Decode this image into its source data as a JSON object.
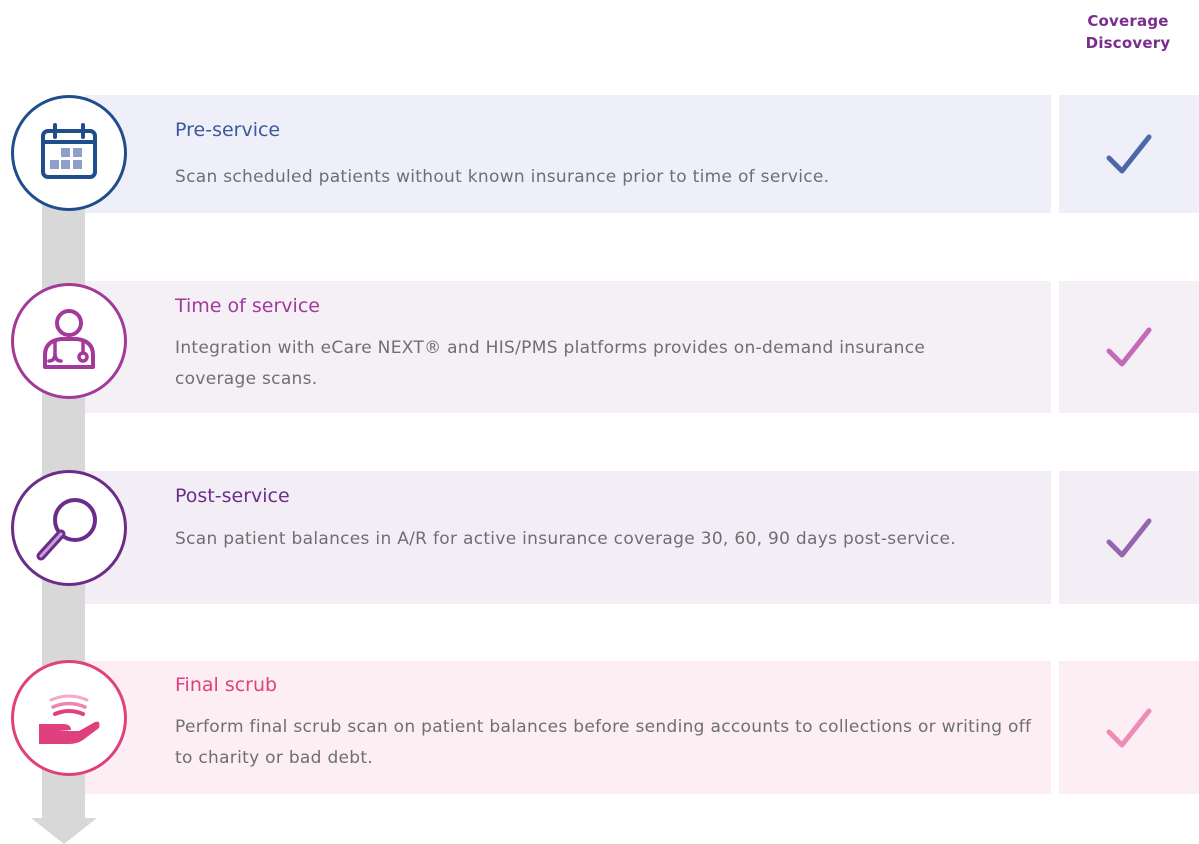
{
  "header": {
    "line1": "Coverage",
    "line2": "Discovery",
    "color": "#7b2d8e"
  },
  "timeline": {
    "bar_color": "#d8d8d9"
  },
  "stages": [
    {
      "title": "Pre-service",
      "description": "Scan scheduled patients without known insurance prior to time of service.",
      "icon": "calendar-icon",
      "accent_color": "#1f4e8c",
      "title_color": "#3b5a99",
      "box_color": "#eeeff8",
      "check_color": "#4e67a8"
    },
    {
      "title": "Time of service",
      "description": "Integration with eCare NEXT® and HIS/PMS platforms provides on-demand insurance coverage scans.",
      "icon": "doctor-stethoscope-icon",
      "accent_color": "#a3399a",
      "title_color": "#a3399a",
      "box_color": "#f5eff6",
      "check_color": "#c46ab8"
    },
    {
      "title": "Post-service",
      "description": "Scan patient balances in A/R for active insurance coverage 30, 60, 90 days post-service.",
      "icon": "magnifying-glass-icon",
      "accent_color": "#6b2d8a",
      "title_color": "#6b2d8a",
      "box_color": "#f3eef5",
      "check_color": "#9565b0"
    },
    {
      "title": "Final scrub",
      "description": "Perform final scrub scan on patient balances before sending accounts to collections or writing off to charity or bad debt.",
      "icon": "hand-scan-icon",
      "accent_color": "#e0407e",
      "title_color": "#e0407e",
      "box_color": "#fdeef4",
      "check_color": "#f08bb8"
    }
  ]
}
